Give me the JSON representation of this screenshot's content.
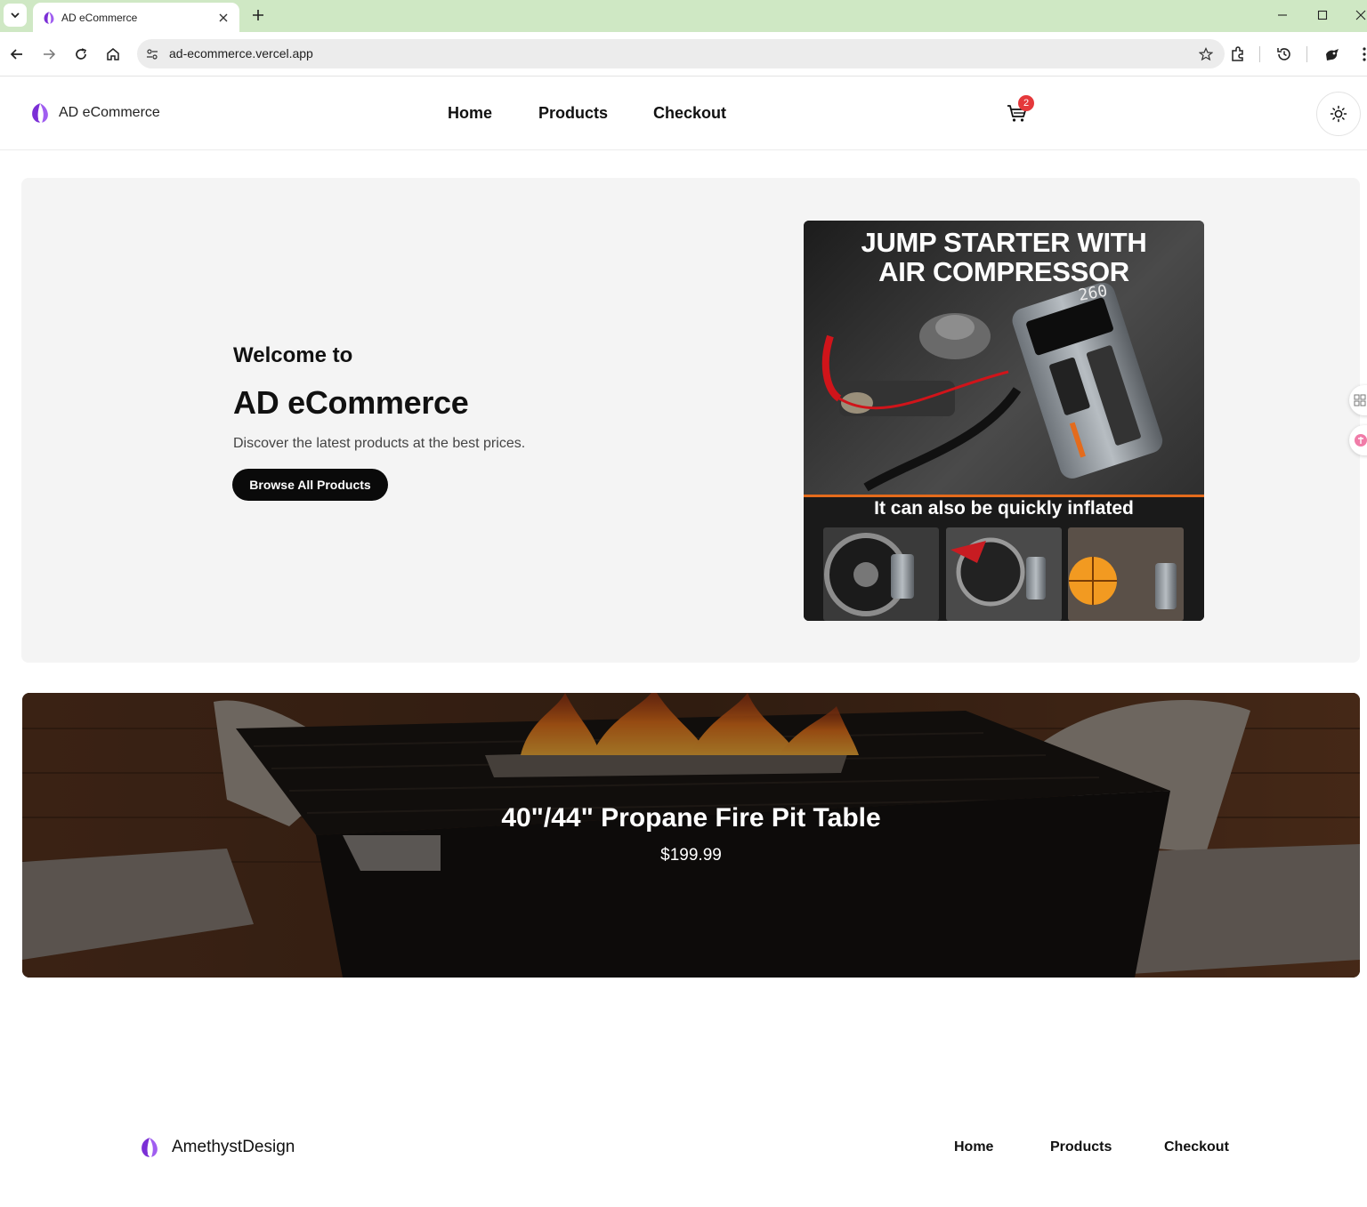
{
  "browser": {
    "tab_title": "AD eCommerce",
    "url": "ad-ecommerce.vercel.app"
  },
  "header": {
    "brand": "AD eCommerce",
    "nav": [
      "Home",
      "Products",
      "Checkout"
    ],
    "cart_count": "2"
  },
  "hero": {
    "welcome": "Welcome to",
    "title": "AD eCommerce",
    "subtitle": "Discover the latest products at the best prices.",
    "button": "Browse All Products",
    "image_title_line1": "JUMP STARTER WITH",
    "image_title_line2": "AIR COMPRESSOR",
    "image_caption": "It can also be quickly inflated",
    "image_display": "260"
  },
  "feature": {
    "title": "40\"/44\" Propane Fire Pit Table",
    "price": "$199.99"
  },
  "footer": {
    "brand": "AmethystDesign",
    "nav": [
      "Home",
      "Products",
      "Checkout"
    ]
  },
  "colors": {
    "tabbar": "#cfe8c4",
    "brand_purple": "#7b2fd6",
    "badge_red": "#e5383b",
    "hero_bg": "#f4f4f4"
  },
  "icons": [
    "chevron-down-icon",
    "close-icon",
    "plus-icon",
    "back-icon",
    "forward-icon",
    "reload-icon",
    "home-icon",
    "site-settings-icon",
    "star-icon",
    "extensions-icon",
    "history-icon",
    "profile-icon",
    "menu-icon",
    "cart-icon",
    "sun-icon",
    "logo-icon"
  ]
}
